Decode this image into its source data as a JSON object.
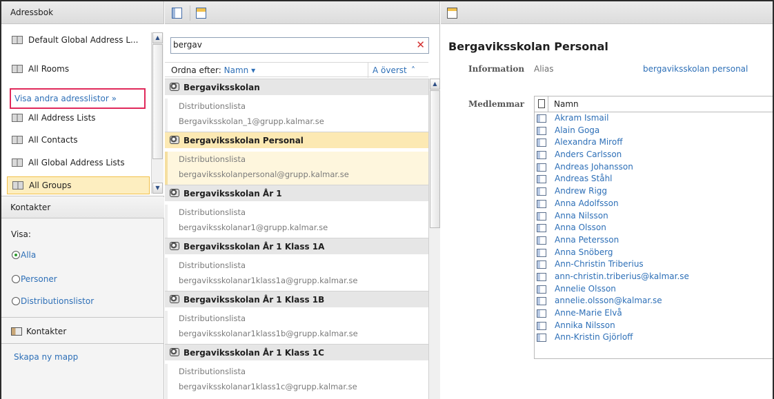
{
  "left_nav": {
    "header": "Adressbok",
    "address_lists": [
      {
        "label": "Default Global Address L...",
        "selected": false
      },
      {
        "label": "All Rooms",
        "selected": false
      },
      {
        "label": "All Address Lists",
        "selected": false
      },
      {
        "label": "All Contacts",
        "selected": false
      },
      {
        "label": "All Global Address Lists",
        "selected": false
      },
      {
        "label": "All Groups",
        "selected": true
      }
    ],
    "show_other_lists": "Visa andra adresslistor »",
    "contacts_header": "Kontakter",
    "show_label": "Visa:",
    "filters": [
      {
        "label": "Alla",
        "checked": true
      },
      {
        "label": "Personer",
        "checked": false
      },
      {
        "label": "Distributionslistor",
        "checked": false
      }
    ],
    "contacts_folder": "Kontakter",
    "new_folder": "Skapa ny mapp"
  },
  "middle": {
    "search_value": "bergav",
    "clear_icon": "✕",
    "sort_label": "Ordna efter:",
    "sort_field": "Namn ▾",
    "sort_order": "A överst  ˄",
    "results": [
      {
        "name": "Bergaviksskolan",
        "type": "Distributionslista",
        "email": "Bergaviksskolan_1@grupp.kalmar.se",
        "selected": false
      },
      {
        "name": "Bergaviksskolan Personal",
        "type": "Distributionslista",
        "email": "bergaviksskolanpersonal@grupp.kalmar.se",
        "selected": true
      },
      {
        "name": "Bergaviksskolan År 1",
        "type": "Distributionslista",
        "email": "bergaviksskolanar1@grupp.kalmar.se",
        "selected": false
      },
      {
        "name": "Bergaviksskolan År 1 Klass 1A",
        "type": "Distributionslista",
        "email": "bergaviksskolanar1klass1a@grupp.kalmar.se",
        "selected": false
      },
      {
        "name": "Bergaviksskolan År 1 Klass 1B",
        "type": "Distributionslista",
        "email": "bergaviksskolanar1klass1b@grupp.kalmar.se",
        "selected": false
      },
      {
        "name": "Bergaviksskolan År 1 Klass 1C",
        "type": "Distributionslista",
        "email": "bergaviksskolanar1klass1c@grupp.kalmar.se",
        "selected": false
      }
    ]
  },
  "detail": {
    "title": "Bergaviksskolan Personal",
    "info_label": "Information",
    "alias_label": "Alias",
    "alias_value": "bergaviksskolan personal",
    "members_label": "Medlemmar",
    "members_header": "Namn",
    "members": [
      "Akram Ismail",
      "Alain Goga",
      "Alexandra Miroff",
      "Anders Carlsson",
      "Andreas Johansson",
      "Andreas Ståhl",
      "Andrew Rigg",
      "Anna Adolfsson",
      "Anna Nilsson",
      "Anna Olsson",
      "Anna Petersson",
      "Anna Snöberg",
      "Ann-Christin Triberius",
      "ann-christin.triberius@kalmar.se",
      "Annelie Olsson",
      "annelie.olsson@kalmar.se",
      "Anne-Marie Elvå",
      "Annika Nilsson",
      "Ann-Kristin Gjörloff"
    ]
  }
}
